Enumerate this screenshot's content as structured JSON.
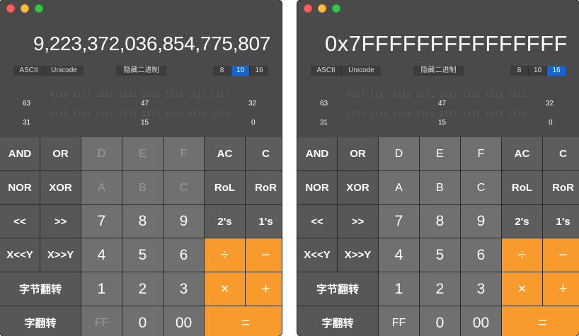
{
  "windows": [
    {
      "display": "9,223,372,036,854,775,807",
      "encoding": [
        "ASCII",
        "Unicode"
      ],
      "hide_label": "隐藏二进制",
      "bases": [
        "8",
        "10",
        "16"
      ],
      "active_base": "10",
      "bits_row1": "0111 1111 1111 1111 1111 1111 1111 1111",
      "bits_row2": "1111 1111 1111 1111 1111 1111 1111 1111",
      "idx_row1": [
        "63",
        "47",
        "32"
      ],
      "idx_row2": [
        "31",
        "15",
        "0"
      ],
      "keys": {
        "and": "AND",
        "or": "OR",
        "d": "D",
        "e": "E",
        "f": "F",
        "ac": "AC",
        "c": "C",
        "nor": "NOR",
        "xor": "XOR",
        "a": "A",
        "b": "B",
        "chex": "C",
        "rol": "RoL",
        "ror": "RoR",
        "shl": "<<",
        "shr": ">>",
        "n7": "7",
        "n8": "8",
        "n9": "9",
        "twos": "2's",
        "ones": "1's",
        "xshl": "X<<Y",
        "xshr": "X>>Y",
        "n4": "4",
        "n5": "5",
        "n6": "6",
        "div": "÷",
        "minus": "−",
        "byteflip": "字节翻转",
        "n1": "1",
        "n2": "2",
        "n3": "3",
        "mul": "×",
        "plus": "+",
        "wordflip": "字翻转",
        "ff": "FF",
        "n0": "0",
        "n00": "00",
        "eq": "="
      }
    },
    {
      "display": "0x7FFFFFFFFFFFFFFF",
      "encoding": [
        "ASCII",
        "Unicode"
      ],
      "hide_label": "隐藏二进制",
      "bases": [
        "8",
        "10",
        "16"
      ],
      "active_base": "16",
      "bits_row1": "0111 1111 1111 1111 1111 1111 1111 1111",
      "bits_row2": "1111 1111 1111 1111 1111 1111 1111 1111",
      "idx_row1": [
        "63",
        "47",
        "32"
      ],
      "idx_row2": [
        "31",
        "15",
        "0"
      ],
      "keys": {
        "and": "AND",
        "or": "OR",
        "d": "D",
        "e": "E",
        "f": "F",
        "ac": "AC",
        "c": "C",
        "nor": "NOR",
        "xor": "XOR",
        "a": "A",
        "b": "B",
        "chex": "C",
        "rol": "RoL",
        "ror": "RoR",
        "shl": "<<",
        "shr": ">>",
        "n7": "7",
        "n8": "8",
        "n9": "9",
        "twos": "2's",
        "ones": "1's",
        "xshl": "X<<Y",
        "xshr": "X>>Y",
        "n4": "4",
        "n5": "5",
        "n6": "6",
        "div": "÷",
        "minus": "−",
        "byteflip": "字节翻转",
        "n1": "1",
        "n2": "2",
        "n3": "3",
        "mul": "×",
        "plus": "+",
        "wordflip": "字翻转",
        "ff": "FF",
        "n0": "0",
        "n00": "00",
        "eq": "="
      }
    }
  ],
  "colors": {
    "operator_orange": "#f89a2c",
    "active_base_blue": "#1464d2",
    "close": "#fc605c",
    "minimize": "#fdbc40",
    "zoom": "#34c84a"
  }
}
